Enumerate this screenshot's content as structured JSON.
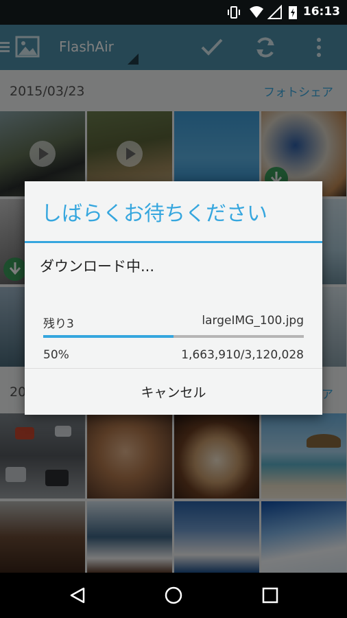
{
  "status_bar": {
    "time": "16:13"
  },
  "app_bar": {
    "title": "FlashAir"
  },
  "gallery": {
    "section1": {
      "date": "2015/03/23",
      "share_label": "フォトシェア"
    },
    "section2": {
      "date_partial": "20",
      "share_partial": "ア"
    }
  },
  "dialog": {
    "title": "しばらくお待ちください",
    "message": "ダウンロード中...",
    "remaining_label": "残り3",
    "filename": "largeIMG_100.jpg",
    "percent_label": "50%",
    "progress_fraction": 0.5,
    "bytes_label": "1,663,910/3,120,028",
    "cancel_label": "キャンセル"
  },
  "colors": {
    "accent": "#35a6de",
    "appbar": "#4d8fa8"
  }
}
